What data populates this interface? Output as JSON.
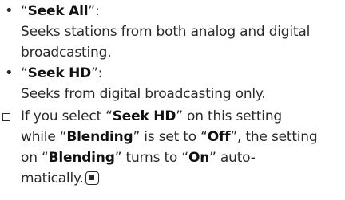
{
  "items": [
    {
      "option_open_quote": "“",
      "option_name": "Seek All",
      "option_close": "”:",
      "description_lines": [
        "Seeks stations from both analog and digital",
        "broadcasting."
      ]
    },
    {
      "option_open_quote": "“",
      "option_name": "Seek HD",
      "option_close": "”:",
      "description_lines": [
        "Seeks from digital broadcasting only."
      ]
    }
  ],
  "note": {
    "l1_a": "If you select “",
    "l1_b": "Seek HD",
    "l1_c": "” on this setting",
    "l2_a": "while “",
    "l2_b": "Blending",
    "l2_c": "” is set to “",
    "l2_d": "Off",
    "l2_e": "”, the setting",
    "l3_a": "on “",
    "l3_b": "Blending",
    "l3_c": "” turns to “",
    "l3_d": "On",
    "l3_e": "” auto-",
    "l4_a": "matically."
  }
}
